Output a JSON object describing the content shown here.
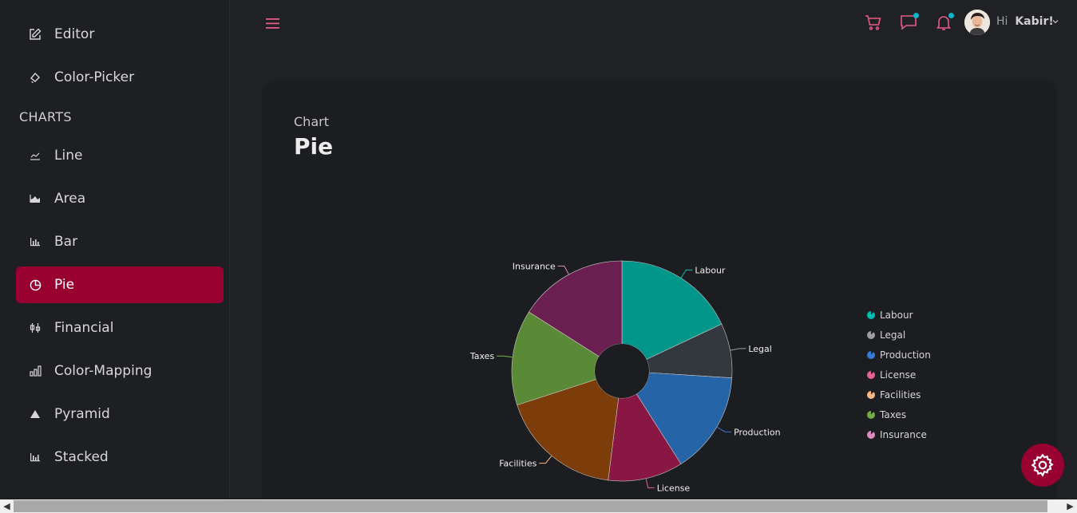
{
  "sidebar": {
    "items_top": [
      {
        "label": "Editor",
        "icon": "edit-icon"
      },
      {
        "label": "Color-Picker",
        "icon": "paint-bucket-icon"
      }
    ],
    "section": "CHARTS",
    "items": [
      {
        "label": "Line",
        "icon": "line-chart-icon"
      },
      {
        "label": "Area",
        "icon": "area-chart-icon"
      },
      {
        "label": "Bar",
        "icon": "bar-chart-icon"
      },
      {
        "label": "Pie",
        "icon": "pie-chart-icon",
        "active": true
      },
      {
        "label": "Financial",
        "icon": "candlestick-icon"
      },
      {
        "label": "Color-Mapping",
        "icon": "column-chart-icon"
      },
      {
        "label": "Pyramid",
        "icon": "pyramid-icon"
      },
      {
        "label": "Stacked",
        "icon": "stacked-bar-icon"
      }
    ]
  },
  "header": {
    "greeting": "Hi",
    "user": "Kabir!",
    "accent": "#e65a84",
    "badge_color": "#11b5c9"
  },
  "page": {
    "subtitle": "Chart",
    "title": "Pie"
  },
  "chart_data": {
    "type": "pie",
    "donut": true,
    "categories": [
      "Labour",
      "Legal",
      "Production",
      "License",
      "Facilities",
      "Taxes",
      "Insurance"
    ],
    "values": [
      18,
      8,
      15,
      11,
      18,
      14,
      16
    ],
    "colors": [
      "#00968a",
      "#33373e",
      "#2664a8",
      "#8a1643",
      "#7c3d0a",
      "#5b8a37",
      "#6b1f51"
    ],
    "legend_colors": [
      "#00bdae",
      "#9e9e9e",
      "#357cd2",
      "#e56590",
      "#f8b883",
      "#70ad47",
      "#dd8abd"
    ],
    "legend_position": "right"
  }
}
